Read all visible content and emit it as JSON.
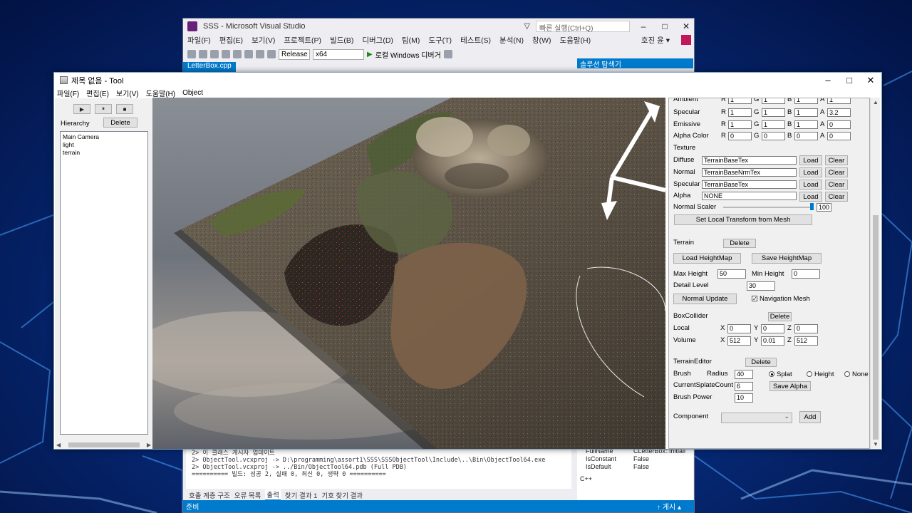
{
  "vs": {
    "title": "SSS - Microsoft Visual Studio",
    "quick_launch": "빠른 실행(Ctrl+Q)",
    "user": "호진 윤 ▾",
    "menu": [
      "파일(F)",
      "편집(E)",
      "보기(V)",
      "프로젝트(P)",
      "빌드(B)",
      "디버그(D)",
      "팀(M)",
      "도구(T)",
      "테스트(S)",
      "분석(N)",
      "창(W)",
      "도움말(H)"
    ],
    "config": "Release",
    "platform": "x64",
    "debug_target": "로컬 Windows 디버거",
    "doc_tab": "LetterBox.cpp",
    "solution_explorer": "솔루션 탐색기",
    "output_lines": [
      "2>  이 클래스 게시자 업데이트",
      "2>  ObjectTool.vcxproj -> D:\\programming\\assort1\\SSS\\SSSObjectTool\\Include\\..\\Bin\\ObjectTool64.exe",
      "2>  ObjectTool.vcxproj -> ../Bin/ObjectTool64.pdb (Full PDB)",
      "========== 빌드: 성공 2, 실패 0, 최신 0, 생략 0 =========="
    ],
    "output_tabs": [
      "호출 계층 구조",
      "오류 목록",
      "출력",
      "찾기 결과 1",
      "기호 찾기 결과"
    ],
    "props": [
      {
        "name": "FullName",
        "value": "CLetterBox::Initiali"
      },
      {
        "name": "IsConstant",
        "value": "False"
      },
      {
        "name": "IsDefault",
        "value": "False"
      }
    ],
    "props_footer": "C++",
    "status_left": "준비",
    "status_right": "↑ 게시 ▴"
  },
  "tool": {
    "title": "제목 없음 - Tool",
    "menu": [
      "파일(F)",
      "편집(E)",
      "보기(V)",
      "도움말(H)",
      "Object"
    ],
    "play_glyphs": [
      "▶",
      "⏸",
      "■"
    ],
    "hierarchy_label": "Hierarchy",
    "delete_label": "Delete",
    "hierarchy_items": [
      "Main Camera",
      "light",
      "terrain"
    ]
  },
  "inspector": {
    "ambient": {
      "label": "Ambient",
      "r": "1",
      "g": "1",
      "b": "1",
      "a": "1"
    },
    "specular": {
      "label": "Specular",
      "r": "1",
      "g": "1",
      "b": "1",
      "a": "3.2"
    },
    "emissive": {
      "label": "Emissive",
      "r": "1",
      "g": "1",
      "b": "1",
      "a": "0"
    },
    "alpha_color": {
      "label": "Alpha Color",
      "r": "0",
      "g": "0",
      "b": "0",
      "a": "0"
    },
    "channel_labels": {
      "r": "R",
      "g": "G",
      "b": "B",
      "a": "A"
    },
    "texture_label": "Texture",
    "textures": [
      {
        "label": "Diffuse",
        "value": "TerrainBaseTex"
      },
      {
        "label": "Normal",
        "value": "TerrainBaseNrmTex"
      },
      {
        "label": "Specular",
        "value": "TerrainBaseTex"
      },
      {
        "label": "Alpha",
        "value": "NONE"
      }
    ],
    "load_label": "Load",
    "clear_label": "Clear",
    "normal_scaler_label": "Normal Scaler",
    "normal_scaler_value": "100",
    "normal_scaler_fraction": 0.98,
    "set_local_transform": "Set Local Transform from Mesh",
    "terrain_label": "Terrain",
    "delete_label": "Delete",
    "load_heightmap": "Load HeightMap",
    "save_heightmap": "Save HeightMap",
    "max_height_label": "Max Height",
    "max_height": "50",
    "min_height_label": "Min Height",
    "min_height": "0",
    "detail_level_label": "Detail Level",
    "detail_level": "30",
    "normal_update": "Normal Update",
    "nav_mesh_label": "Navigation Mesh",
    "nav_mesh_checked": true,
    "box_collider_label": "BoxCollider",
    "local_label": "Local",
    "local": {
      "x": "0",
      "y": "0",
      "z": "0"
    },
    "volume_label": "Volume",
    "volume": {
      "x": "512",
      "y": "0.01",
      "z": "512"
    },
    "axis_labels": {
      "x": "X",
      "y": "Y",
      "z": "Z"
    },
    "terrain_editor_label": "TerrainEditor",
    "brush_label": "Brush",
    "radius_label": "Radius",
    "radius": "40",
    "brush_modes": [
      "Splat",
      "Height",
      "None"
    ],
    "brush_mode_selected": "Splat",
    "current_splat_label": "CurrentSplateCount",
    "current_splat": "6",
    "save_alpha": "Save Alpha",
    "brush_power_label": "Brush Power",
    "brush_power": "10",
    "component_label": "Component",
    "add_label": "Add"
  }
}
